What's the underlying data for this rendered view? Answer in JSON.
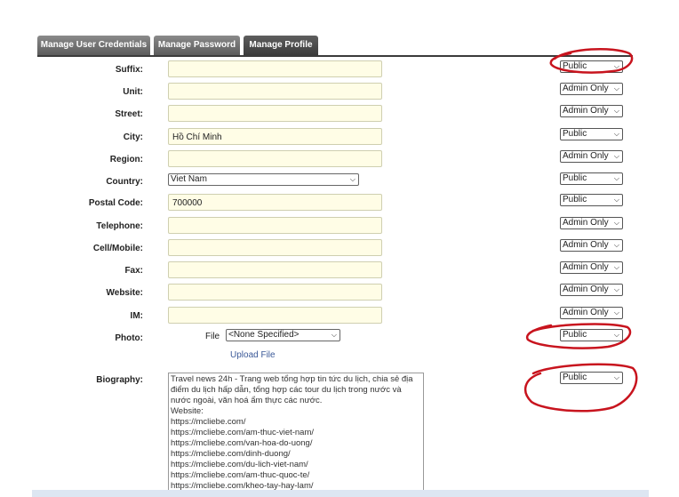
{
  "tabs": [
    {
      "label": "Manage User Credentials",
      "active": false
    },
    {
      "label": "Manage Password",
      "active": false
    },
    {
      "label": "Manage Profile",
      "active": true
    }
  ],
  "fields": {
    "suffix": {
      "label": "Suffix:",
      "value": "",
      "visibility": "Public"
    },
    "unit": {
      "label": "Unit:",
      "value": "",
      "visibility": "Admin Only"
    },
    "street": {
      "label": "Street:",
      "value": "",
      "visibility": "Admin Only"
    },
    "city": {
      "label": "City:",
      "value": "Hồ Chí Minh",
      "visibility": "Public"
    },
    "region": {
      "label": "Region:",
      "value": "",
      "visibility": "Admin Only"
    },
    "country": {
      "label": "Country:",
      "value": "Viet Nam",
      "visibility": "Public"
    },
    "postal": {
      "label": "Postal Code:",
      "value": "700000",
      "visibility": "Public"
    },
    "telephone": {
      "label": "Telephone:",
      "value": "",
      "visibility": "Admin Only"
    },
    "cell": {
      "label": "Cell/Mobile:",
      "value": "",
      "visibility": "Admin Only"
    },
    "fax": {
      "label": "Fax:",
      "value": "",
      "visibility": "Admin Only"
    },
    "website": {
      "label": "Website:",
      "value": "",
      "visibility": "Admin Only"
    },
    "im": {
      "label": "IM:",
      "value": "",
      "visibility": "Admin Only"
    },
    "photo": {
      "label": "Photo:",
      "file_label": "File",
      "file_value": "<None Specified>",
      "upload_label": "Upload File",
      "visibility": "Public"
    },
    "biography": {
      "label": "Biography:",
      "visibility": "Public",
      "text": "Travel news 24h - Trang web tổng hợp tin tức du lịch, chia sẻ địa điểm du lịch hấp dẫn, tổng hợp các tour du lịch trong nước và nước ngoài, văn hoá ẩm thực các nước.\nWebsite:\nhttps://mcliebe.com/\nhttps://mcliebe.com/am-thuc-viet-nam/\nhttps://mcliebe.com/van-hoa-do-uong/\nhttps://mcliebe.com/dinh-duong/\nhttps://mcliebe.com/du-lich-viet-nam/\nhttps://mcliebe.com/am-thuc-quoc-te/\nhttps://mcliebe.com/kheo-tay-hay-lam/\nhttps://mcliebe.com/am-thuc-gia-dinh/"
    }
  },
  "colors": {
    "annotation": "#c8141e",
    "field_bg": "#fffde6",
    "tab_active": "#3a3a3a",
    "tab_inactive": "#6e6e6e"
  }
}
